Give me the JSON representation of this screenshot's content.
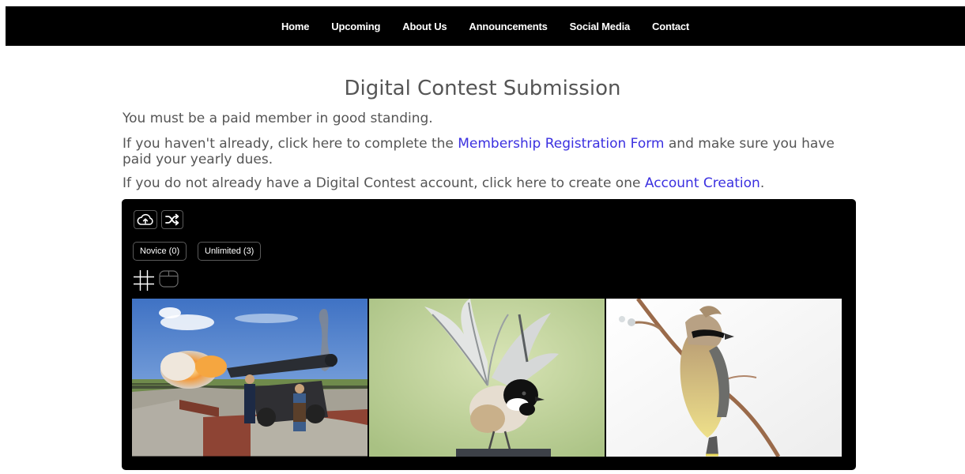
{
  "nav": {
    "items": [
      {
        "label": "Home"
      },
      {
        "label": "Upcoming"
      },
      {
        "label": "About Us"
      },
      {
        "label": "Announcements"
      },
      {
        "label": "Social Media"
      },
      {
        "label": "Contact"
      }
    ]
  },
  "page": {
    "title": "Digital Contest Submission",
    "line1": "You must be a paid member in good standing.",
    "line2_before": "If you haven't already, click here to complete the ",
    "line2_link": "Membership Registration Form",
    "line2_after": " and make sure you have paid your yearly dues.",
    "line3_before": "If you do not already have a Digital Contest account, click here to create one ",
    "line3_link": "Account Creation",
    "line3_after": "."
  },
  "gallery": {
    "toolbar_icons": [
      "cloud-upload-icon",
      "shuffle-icon"
    ],
    "categories": [
      {
        "label": "Novice (0)"
      },
      {
        "label": "Unlimited (3)"
      }
    ],
    "view_icons": [
      "grid-view-icon",
      "single-view-icon"
    ],
    "photos": [
      {
        "subject": "cannon-firing-photo"
      },
      {
        "subject": "chickadee-photo"
      },
      {
        "subject": "cedar-waxwing-photo"
      }
    ]
  },
  "colors": {
    "nav_bg": "#000000",
    "link": "#3b30e0",
    "text": "#555555",
    "panel_bg": "#000000"
  }
}
